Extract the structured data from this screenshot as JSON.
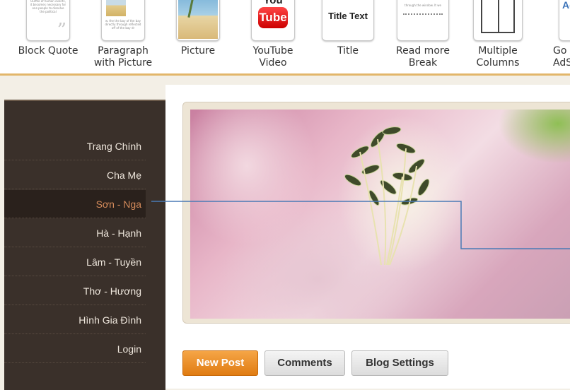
{
  "toolbar": {
    "items": [
      {
        "label": "Block Quote",
        "thumb_text": "Outfile of human events, it becomes necessary for one people to dissolve the political"
      },
      {
        "label": "Paragraph\nwith Picture",
        "thumb_text": "w. the the bay of the bay directly through reflected off of the bay dr"
      },
      {
        "label": "Picture"
      },
      {
        "label": "YouTube\nVideo",
        "thumb_you": "You",
        "thumb_tube": "Tube"
      },
      {
        "label": "Title",
        "thumb_title": "Title Text"
      },
      {
        "label": "Read more\nBreak",
        "thumb_text": "through the window. It we"
      },
      {
        "label": "Multiple\nColumns"
      },
      {
        "label": "Go\nAdS",
        "thumb_ads": "AdS"
      }
    ]
  },
  "sidebar": {
    "items": [
      {
        "label": "Trang Chính"
      },
      {
        "label": "Cha Mẹ"
      },
      {
        "label": "Sơn - Nga",
        "active": true
      },
      {
        "label": "Hà - Hạnh"
      },
      {
        "label": "Lâm - Tuyền"
      },
      {
        "label": "Thơ - Hương"
      },
      {
        "label": "Hình Gia Đình"
      },
      {
        "label": "Login"
      }
    ]
  },
  "main": {
    "buttons": {
      "new_post": "New Post",
      "comments": "Comments",
      "blog_settings": "Blog Settings"
    }
  },
  "colors": {
    "accent": "#e07c12",
    "sidebar_bg": "#3a302a",
    "active_link": "#d38a5a"
  }
}
